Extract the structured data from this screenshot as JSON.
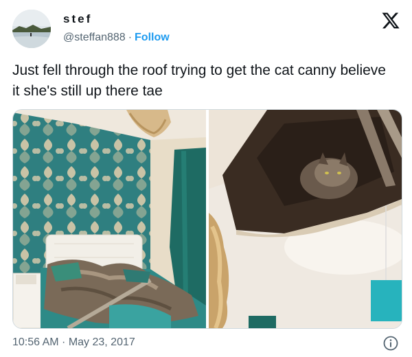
{
  "user": {
    "display_name": "stef",
    "handle": "@steffan888",
    "separator": "·",
    "follow_label": "Follow"
  },
  "tweet": {
    "text": "Just fell through the roof trying to get the cat canny believe it she's still up there tae"
  },
  "media": {
    "count": 2
  },
  "footer": {
    "timestamp": "10:56 AM · May 23, 2017"
  },
  "icons": {
    "brand": "x-logo-icon",
    "info": "info-icon"
  },
  "colors": {
    "link": "#1d9bf0",
    "secondary_text": "#536471",
    "primary_text": "#0f1419"
  }
}
